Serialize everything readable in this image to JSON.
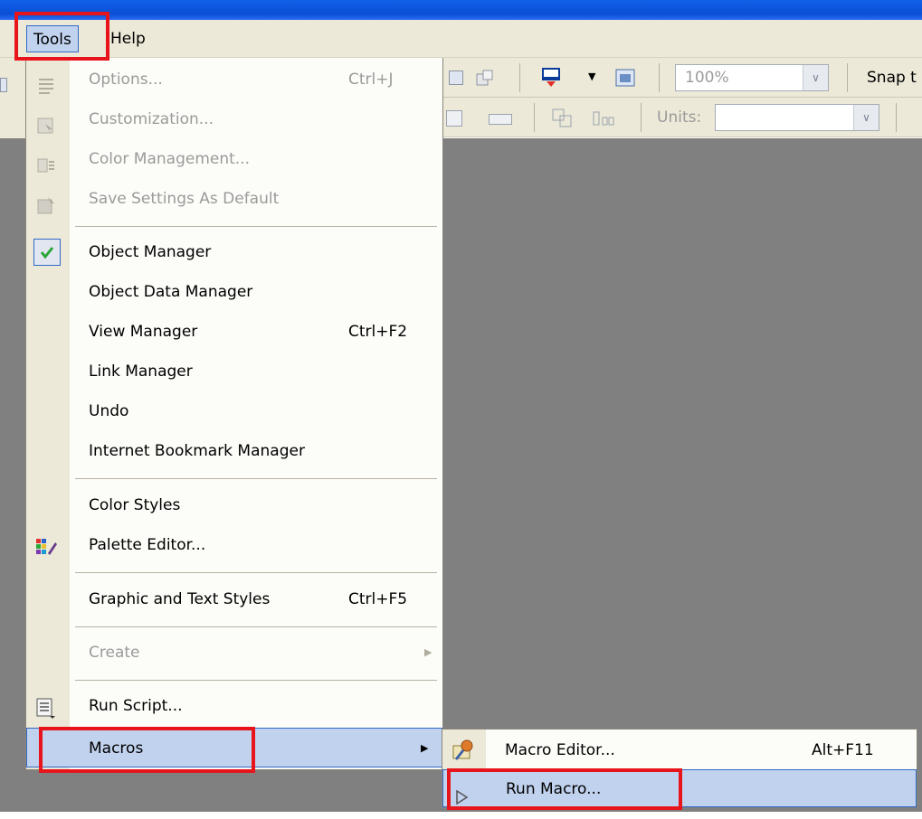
{
  "menubar": {
    "tools": "Tools",
    "help": "Help"
  },
  "toolbar": {
    "zoom": "100%",
    "snap": "Snap t",
    "units_label": "Units:"
  },
  "tools_menu": {
    "items": [
      {
        "label": "Options...",
        "shortcut": "Ctrl+J",
        "enabled": false,
        "icon": "options-icon"
      },
      {
        "label": "Customization...",
        "shortcut": "",
        "enabled": false,
        "icon": "customization-icon"
      },
      {
        "label": "Color Management...",
        "shortcut": "",
        "enabled": false,
        "icon": "color-management-icon"
      },
      {
        "label": "Save Settings As Default",
        "shortcut": "",
        "enabled": false,
        "icon": "save-settings-icon"
      },
      {
        "label": "Object Manager",
        "shortcut": "",
        "enabled": true,
        "checked": true,
        "icon": "checkmark-icon"
      },
      {
        "label": "Object Data Manager",
        "shortcut": "",
        "enabled": true
      },
      {
        "label": "View Manager",
        "shortcut": "Ctrl+F2",
        "enabled": true
      },
      {
        "label": "Link Manager",
        "shortcut": "",
        "enabled": true
      },
      {
        "label": "Undo",
        "shortcut": "",
        "enabled": true
      },
      {
        "label": "Internet Bookmark Manager",
        "shortcut": "",
        "enabled": true
      },
      {
        "label": "Color Styles",
        "shortcut": "",
        "enabled": true
      },
      {
        "label": "Palette Editor...",
        "shortcut": "",
        "enabled": true,
        "icon": "palette-editor-icon"
      },
      {
        "label": "Graphic and Text Styles",
        "shortcut": "Ctrl+F5",
        "enabled": true
      },
      {
        "label": "Create",
        "shortcut": "",
        "enabled": false,
        "submenu": true
      },
      {
        "label": "Run Script...",
        "shortcut": "",
        "enabled": true,
        "icon": "run-script-icon"
      },
      {
        "label": "Macros",
        "shortcut": "",
        "enabled": true,
        "submenu": true,
        "highlighted": true
      }
    ]
  },
  "macros_submenu": {
    "items": [
      {
        "label": "Macro Editor...",
        "shortcut": "Alt+F11",
        "icon": "macro-editor-icon"
      },
      {
        "label": "Run Macro...",
        "shortcut": "",
        "icon": "play-triangle-icon",
        "highlighted": true
      }
    ]
  },
  "colors": {
    "highlight_box": "#e8141c",
    "menu_hover": "#c1d2ee",
    "workspace": "#808080"
  }
}
